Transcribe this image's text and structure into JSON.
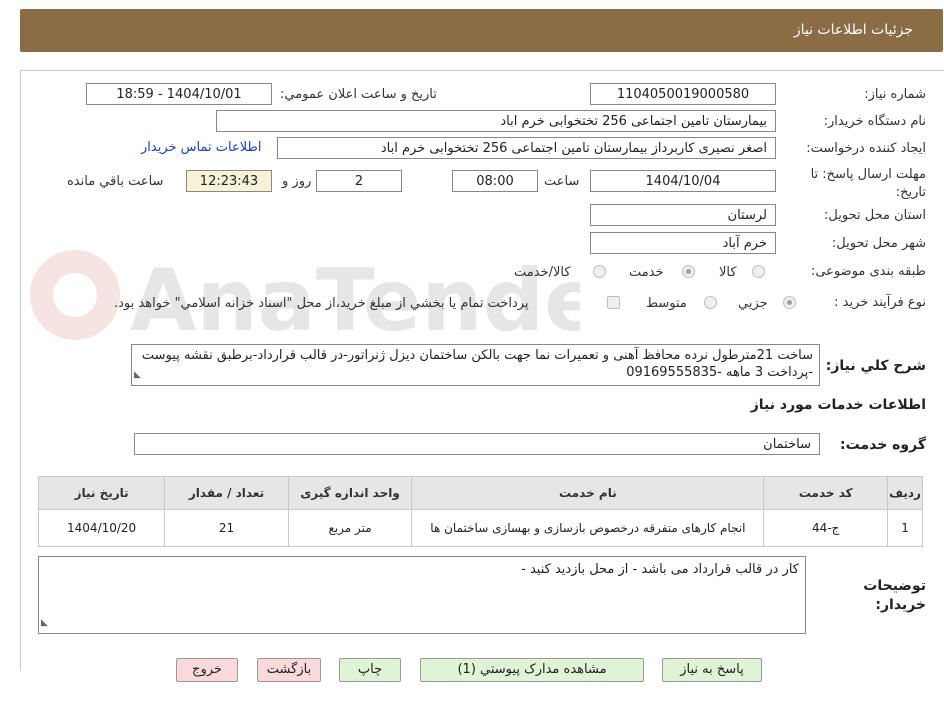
{
  "header": {
    "title": "جزئیات اطلاعات نیاز"
  },
  "form": {
    "need_number_label": "شماره نیاز:",
    "need_number": "1104050019000580",
    "announce_label": "تاریخ و ساعت اعلان عمومي:",
    "announce_value": "1404/10/01 - 18:59",
    "buyer_org_label": "نام دستگاه خريدار:",
    "buyer_org": "بیمارستان تامین اجتماعی  256 تختخوابی خرم اباد",
    "requester_label": "ايجاد كننده درخواست:",
    "requester": "اصغر نصیری کاربرداز بیمارستان تامین اجتماعی  256 تختخوابی خرم اباد",
    "buyer_contact_link": "اطلاعات تماس خريدار",
    "deadline_label": "مهلت ارسال پاسخ: تا تاريخ:",
    "deadline_date": "1404/10/04",
    "hour_label": "ساعت",
    "deadline_time": "08:00",
    "days_value": "2",
    "day_and_label": "روز و",
    "remaining_time": "12:23:43",
    "remaining_label": "ساعت باقي مانده",
    "province_label": "استان محل تحويل:",
    "province": "لرستان",
    "city_label": "شهر محل تحويل:",
    "city": "خرم آباد",
    "category_label": "طبقه بندی موضوعی:",
    "category_options": [
      "كالا",
      "خدمت",
      "كالا/خدمت"
    ],
    "process_label": "نوع فرآيند خريد :",
    "process_options": [
      "جزيي",
      "متوسط"
    ],
    "payment_note": "پرداخت تمام يا بخشي از مبلغ خريد،از محل \"اسناد خزانه اسلامي\" خواهد بود.",
    "description_label": "شرح كلي نياز:",
    "description": "ساخت 21مترطول نرده محافظ آهنی و تعمیرات نما جهت بالکن ساختمان دیزل ژنراتور-در قالب قرارداد-برطبق نقشه پیوست -پرداخت  3 ماهه -09169555835",
    "services_title": "اطلاعات خدمات مورد نياز",
    "service_group_label": "گروه خدمت:",
    "service_group": "ساختمان"
  },
  "table": {
    "headers": [
      "رديف",
      "كد خدمت",
      "نام خدمت",
      "واحد اندازه گيری",
      "تعداد / مقدار",
      "تاريخ نياز"
    ],
    "rows": [
      [
        "1",
        "ج-44",
        "انجام کارهای متفرقه درخصوص بازسازی و بهسازی ساختمان ها",
        "متر مربع",
        "21",
        "1404/10/20"
      ]
    ]
  },
  "buyer_notes_label": "توضيحات خريدار:",
  "buyer_notes": "کار در قالب قرارداد می باشد - از محل بازدید کنید -",
  "buttons": {
    "reply": "پاسخ به نياز",
    "attachments": "مشاهده مدارک پيوستي (1)",
    "print": "چاپ",
    "back": "بازگشت",
    "exit": "خروج"
  },
  "colors": {
    "header_bg": "#8a6d45",
    "link": "#1a3fbf",
    "time_bg": "#f7f3d6"
  },
  "watermark_text": "AnaTender.neT"
}
